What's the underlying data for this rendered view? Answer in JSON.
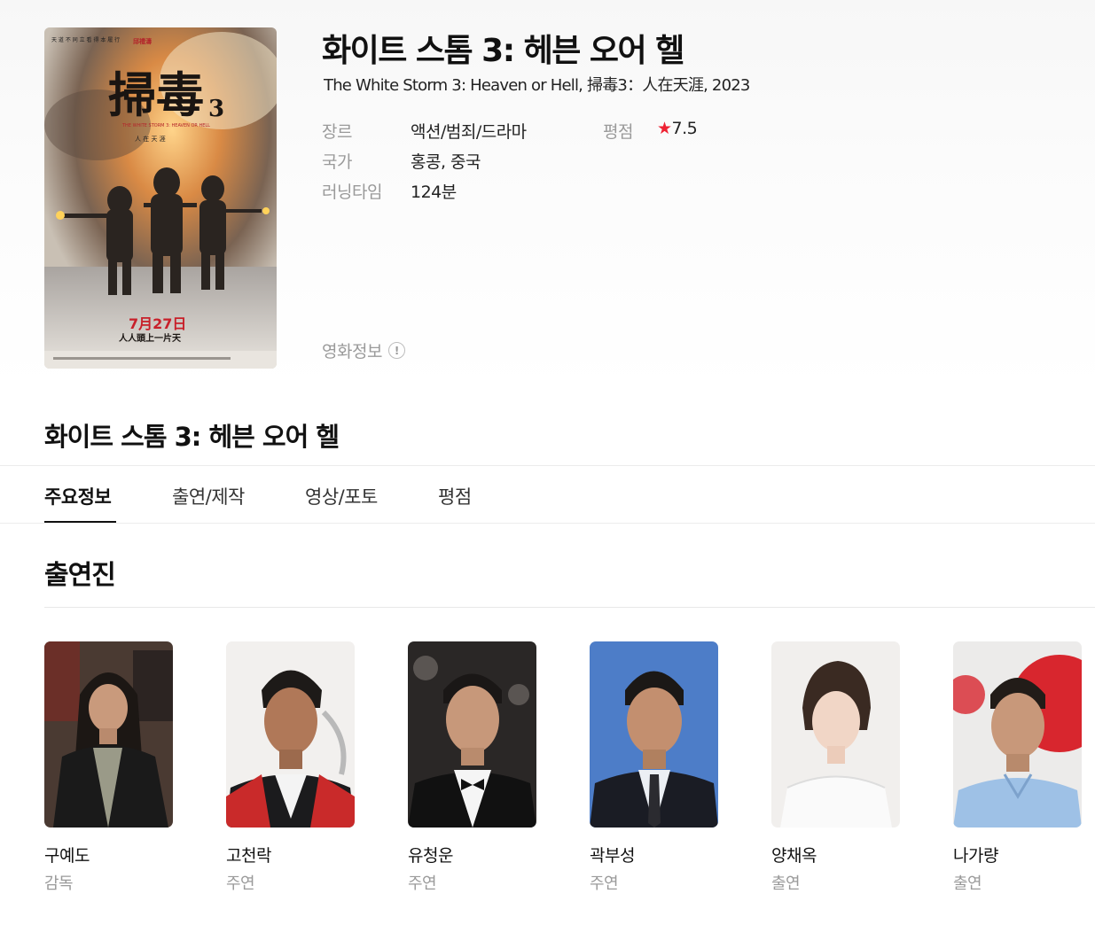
{
  "movie": {
    "title": "화이트 스톰 3: 헤븐 오어 헬",
    "subtitle": "The White Storm 3: Heaven or Hell, 掃毒3：人在天涯, 2023",
    "poster_texts": {
      "chinese_title": "掃毒",
      "number": "3",
      "english": "THE WHITE STORM 3: HEAVEN OR HELL",
      "tagline": "人 在 天 涯",
      "release_date": "7月27日",
      "release_slogan": "人人頭上一片天"
    },
    "meta": {
      "genre_label": "장르",
      "genre_value": "액션/범죄/드라마",
      "country_label": "국가",
      "country_value": "홍콩, 중국",
      "runtime_label": "러닝타임",
      "runtime_value": "124분",
      "rating_label": "평점",
      "rating_star": "★",
      "rating_value": "7.5"
    },
    "info_link": "영화정보",
    "info_icon": "!"
  },
  "section_title": "화이트 스톰 3: 헤븐 오어 헬",
  "tabs": [
    {
      "label": "주요정보",
      "active": true
    },
    {
      "label": "출연/제작",
      "active": false
    },
    {
      "label": "영상/포토",
      "active": false
    },
    {
      "label": "평점",
      "active": false
    }
  ],
  "cast": {
    "heading": "출연진",
    "members": [
      {
        "name": "구예도",
        "role": "감독"
      },
      {
        "name": "고천락",
        "role": "주연"
      },
      {
        "name": "유청운",
        "role": "주연"
      },
      {
        "name": "곽부성",
        "role": "주연"
      },
      {
        "name": "양채옥",
        "role": "출연"
      },
      {
        "name": "나가량",
        "role": "출연"
      }
    ]
  },
  "colors": {
    "accent_star": "#ee2233",
    "text_primary": "#111111",
    "text_muted": "#9a9a9a"
  }
}
